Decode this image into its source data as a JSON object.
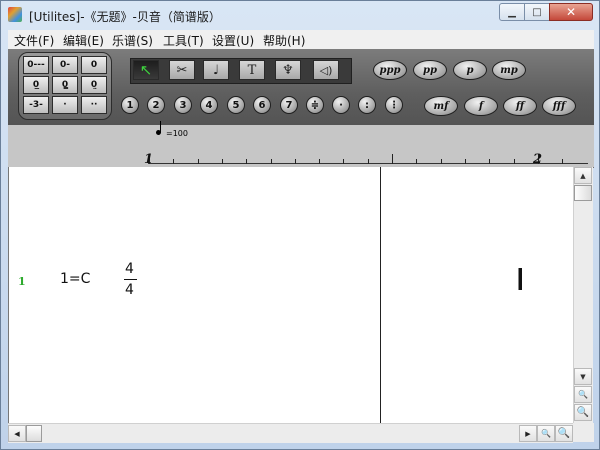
{
  "window": {
    "title": "[Utilites]-《无题》-贝音（简谱版）",
    "min_glyph": "▁",
    "max_glyph": "□",
    "close_glyph": "✕"
  },
  "menu": [
    {
      "label": "文件(F)"
    },
    {
      "label": "编辑(E)"
    },
    {
      "label": "乐谱(S)"
    },
    {
      "label": "工具(T)"
    },
    {
      "label": "设置(U)"
    },
    {
      "label": "帮助(H)"
    }
  ],
  "toolbar": {
    "durations": [
      "0---",
      "0-",
      "0",
      "0̲",
      "0̳",
      "0̤",
      "-3-",
      "·",
      "··"
    ],
    "tools": [
      {
        "name": "select-tool",
        "icon": "arrow-cursor-icon",
        "glyph": "↖"
      },
      {
        "name": "cut-tool",
        "icon": "scissors-icon",
        "glyph": "✂"
      },
      {
        "name": "metronome-tool",
        "icon": "metronome-icon",
        "glyph": "⏳"
      },
      {
        "name": "text-tool",
        "icon": "text-icon",
        "glyph": "T"
      },
      {
        "name": "instrument-tool",
        "icon": "lyre-icon",
        "glyph": "♆"
      },
      {
        "name": "sound-tool",
        "icon": "speaker-icon",
        "glyph": "🔉"
      }
    ],
    "numbers": [
      "1",
      "2",
      "3",
      "4",
      "5",
      "6",
      "7",
      "≑",
      "·",
      ":",
      "⋮"
    ],
    "dynamics_top": [
      "ppp",
      "pp",
      "p",
      "mp"
    ],
    "dynamics_bottom": [
      "mf",
      "f",
      "ff",
      "fff"
    ]
  },
  "ruler": {
    "tempo": "=100",
    "measures": [
      "1",
      "2"
    ]
  },
  "score": {
    "line_number": "1",
    "key": "1=C",
    "time_numerator": "4",
    "time_denominator": "4"
  },
  "scrollbars": {
    "up_glyph": "▲",
    "down_glyph": "▼",
    "left_glyph": "◀",
    "right_glyph": "▶",
    "zoom_glyph": "🔍"
  }
}
